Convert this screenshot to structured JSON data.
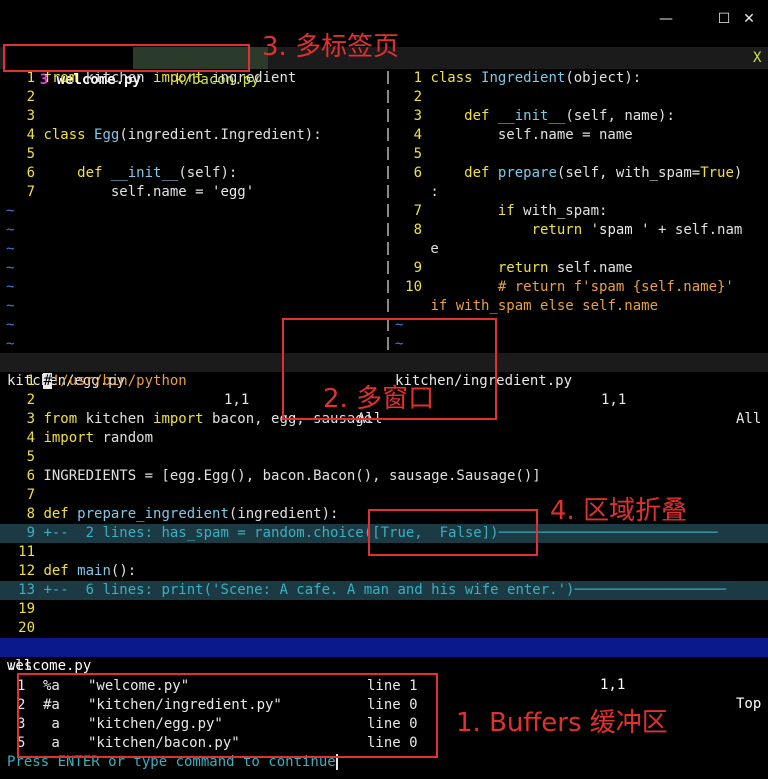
{
  "window": {
    "controls": [
      "—",
      "☐",
      "✕"
    ]
  },
  "tabline": {
    "tabs": [
      {
        "count": "3",
        "label": " welcome.py ",
        "active": true
      },
      {
        "label": " k/bacon.py ",
        "active": false
      }
    ],
    "close_label": "X"
  },
  "pane_left": {
    "lines": [
      {
        "n": "1",
        "code": "from kitchen import ingredient"
      },
      {
        "n": "2",
        "code": ""
      },
      {
        "n": "3",
        "code": ""
      },
      {
        "n": "4",
        "code": "class Egg(ingredient.Ingredient):"
      },
      {
        "n": "5",
        "code": ""
      },
      {
        "n": "6",
        "code": "    def __init__(self):"
      },
      {
        "n": "7",
        "code": "        self.name = 'egg'"
      }
    ],
    "status": {
      "file": "kitchen/egg.py",
      "pos": "1,1",
      "scroll": "All"
    }
  },
  "pane_right": {
    "lines": [
      {
        "n": "1",
        "code": "class Ingredient(object):"
      },
      {
        "n": "2",
        "code": ""
      },
      {
        "n": "3",
        "code": "    def __init__(self, name):"
      },
      {
        "n": "4",
        "code": "        self.name = name"
      },
      {
        "n": "5",
        "code": ""
      },
      {
        "n": "6",
        "code": "    def prepare(self, with_spam=True)"
      },
      {
        "n": "",
        "code": ":"
      },
      {
        "n": "7",
        "code": "        if with_spam:"
      },
      {
        "n": "8",
        "code": "            return 'spam ' + self.nam"
      },
      {
        "n": "",
        "code": "e"
      },
      {
        "n": "9",
        "code": "        return self.name"
      },
      {
        "n": "10",
        "code": "        # return f'spam {self.name}'"
      },
      {
        "n": "",
        "code": "if with_spam else self.name"
      }
    ],
    "status": {
      "file": "kitchen/ingredient.py",
      "pos": "1,1",
      "scroll": "All"
    }
  },
  "pane_bottom": {
    "lines": [
      {
        "n": "1",
        "code": "#!/usr/bin/python"
      },
      {
        "n": "2",
        "code": ""
      },
      {
        "n": "3",
        "code": "from kitchen import bacon, egg, sausage"
      },
      {
        "n": "4",
        "code": "import random"
      },
      {
        "n": "5",
        "code": ""
      },
      {
        "n": "6",
        "code": "INGREDIENTS = [egg.Egg(), bacon.Bacon(), sausage.Sausage()]"
      },
      {
        "n": "7",
        "code": ""
      },
      {
        "n": "8",
        "code": "def prepare_ingredient(ingredient):"
      },
      {
        "n": "9",
        "code": "+--  2 lines: has_spam = random.choice([True,  False])──────────────────────────",
        "fold": true
      },
      {
        "n": "11",
        "code": ""
      },
      {
        "n": "12",
        "code": "def main():"
      },
      {
        "n": "13",
        "code": "+--  6 lines: print('Scene: A cafe. A man and his wife enter.')──────────────────",
        "fold": true
      },
      {
        "n": "19",
        "code": ""
      },
      {
        "n": "20",
        "code": ""
      }
    ],
    "status": {
      "file": "welcome.py",
      "pos": "1,1",
      "scroll": "Top"
    }
  },
  "cmdline": {
    "command": ":ls",
    "buffers": [
      {
        "n": "1",
        "flags": "%a",
        "name": "\"welcome.py\"",
        "line": "line 1"
      },
      {
        "n": "2",
        "flags": "#a",
        "name": "\"kitchen/ingredient.py\"",
        "line": "line 0"
      },
      {
        "n": "3",
        "flags": " a",
        "name": "\"kitchen/egg.py\"",
        "line": "line 0"
      },
      {
        "n": "5",
        "flags": " a",
        "name": "\"kitchen/bacon.py\"",
        "line": "line 0"
      }
    ],
    "prompt": "Press ENTER or type command to continue"
  },
  "annotations": {
    "tabs": "3. 多标签页",
    "windows": "2. 多窗口",
    "fold": "4. 区域折叠",
    "buffers": "1. Buffers 缓冲区"
  },
  "colors": {
    "tab_count": "#e040e0",
    "annotation": "#e03030",
    "status_bottom_bg": "#0a1a8c",
    "tilde": "#3d7fd8"
  }
}
